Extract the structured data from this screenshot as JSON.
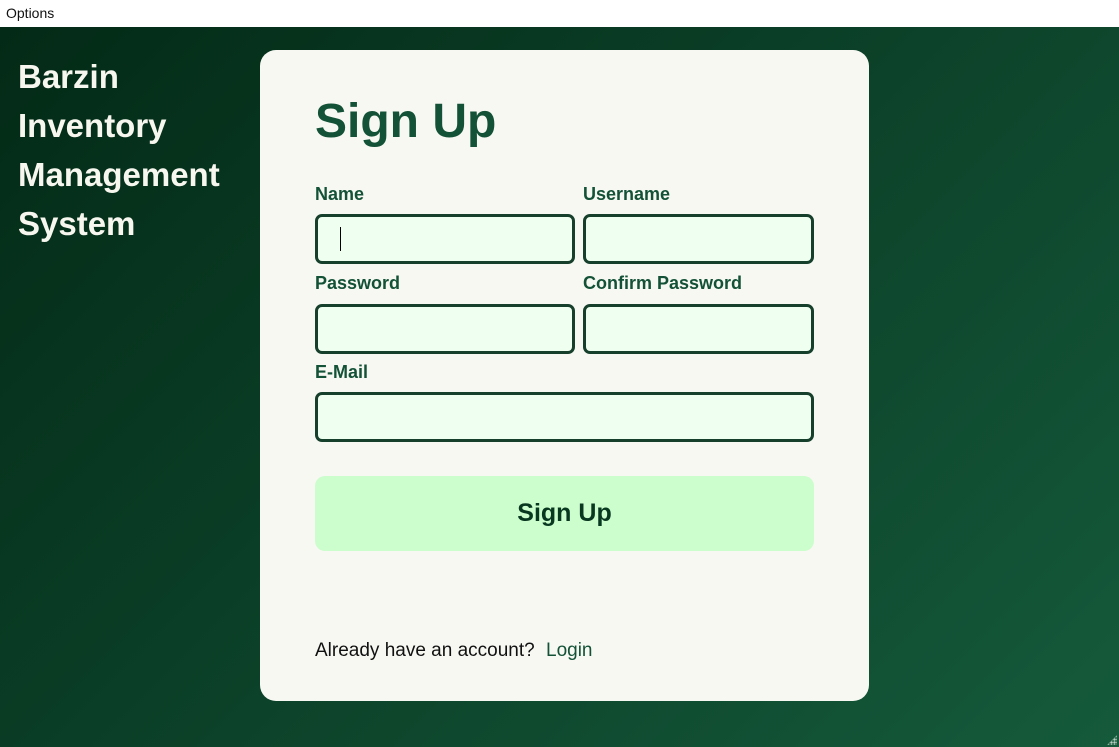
{
  "menu": {
    "options": "Options"
  },
  "brand": {
    "lines": [
      "Barzin",
      "Inventory",
      "Management",
      "System"
    ]
  },
  "form": {
    "title": "Sign Up",
    "name_label": "Name",
    "name_value": "",
    "username_label": "Username",
    "username_value": "",
    "password_label": "Password",
    "password_value": "",
    "confirm_label": "Confirm Password",
    "confirm_value": "",
    "email_label": "E-Mail",
    "email_value": "",
    "submit": "Sign Up",
    "footer_text": "Already have an account?",
    "login_link": "Login"
  }
}
